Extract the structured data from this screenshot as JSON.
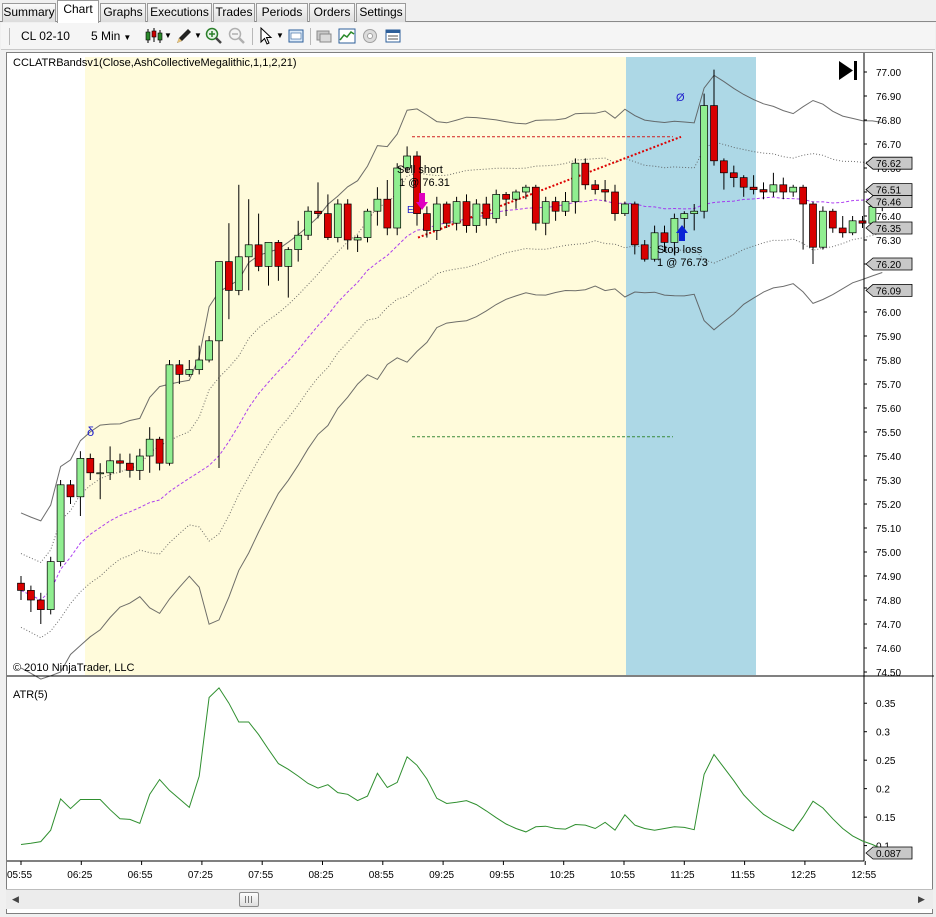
{
  "tabs": [
    "Summary",
    "Chart",
    "Graphs",
    "Executions",
    "Trades",
    "Periods",
    "Orders",
    "Settings"
  ],
  "active_tab": "Chart",
  "toolbar": {
    "instrument": "CL 02-10",
    "interval": "5 Min"
  },
  "chart": {
    "indicator_label": "CCLATRBandsv1(Close,AshCollectiveMegalithic,1,1,2,21)",
    "copyright": "© 2010 NinjaTrader, LLC",
    "atr_label": "ATR(5)",
    "sell_short_label": "Sell short",
    "sell_short_fill": "1 @ 76.31",
    "stop_loss_label": "Stop loss",
    "stop_loss_fill": "1 @ 76.73",
    "entry_marker": "E",
    "swing_low_marker": "δ",
    "swing_high_marker": "Ø"
  },
  "chart_data": {
    "type": "candlestick",
    "y_ticks": [
      "77.00",
      "76.90",
      "76.80",
      "76.70",
      "76.60",
      "76.50",
      "76.40",
      "76.30",
      "76.20",
      "76.10",
      "76.00",
      "75.90",
      "75.80",
      "75.70",
      "75.60",
      "75.50",
      "75.40",
      "75.30",
      "75.20",
      "75.10",
      "75.00",
      "74.90",
      "74.80",
      "74.70",
      "74.60",
      "74.50"
    ],
    "ylim": [
      74.5,
      77.0
    ],
    "x_ticks": [
      "05:55",
      "06:25",
      "06:55",
      "07:25",
      "07:55",
      "08:25",
      "08:55",
      "09:25",
      "09:55",
      "10:25",
      "10:55",
      "11:25",
      "11:55",
      "12:25",
      "12:55"
    ],
    "price_badges": [
      "76.62",
      "76.51",
      "76.46",
      "76.35",
      "76.20",
      "76.09"
    ],
    "atr_ticks": [
      "0.35",
      "0.3",
      "0.25",
      "0.2",
      "0.15",
      "0.1"
    ],
    "atr_ylim": [
      0.087,
      0.375
    ],
    "atr_badge": "0.087",
    "candles": [
      {
        "o": 74.87,
        "h": 74.9,
        "l": 74.8,
        "c": 74.84
      },
      {
        "o": 74.84,
        "h": 74.86,
        "l": 74.75,
        "c": 74.8
      },
      {
        "o": 74.8,
        "h": 74.83,
        "l": 74.7,
        "c": 74.76
      },
      {
        "o": 74.76,
        "h": 74.98,
        "l": 74.74,
        "c": 74.96
      },
      {
        "o": 74.96,
        "h": 75.3,
        "l": 74.94,
        "c": 75.28
      },
      {
        "o": 75.28,
        "h": 75.3,
        "l": 75.2,
        "c": 75.23
      },
      {
        "o": 75.23,
        "h": 75.42,
        "l": 75.15,
        "c": 75.39
      },
      {
        "o": 75.39,
        "h": 75.41,
        "l": 75.3,
        "c": 75.33
      },
      {
        "o": 75.33,
        "h": 75.37,
        "l": 75.22,
        "c": 75.33
      },
      {
        "o": 75.33,
        "h": 75.44,
        "l": 75.3,
        "c": 75.38
      },
      {
        "o": 75.38,
        "h": 75.41,
        "l": 75.33,
        "c": 75.37
      },
      {
        "o": 75.37,
        "h": 75.41,
        "l": 75.31,
        "c": 75.34
      },
      {
        "o": 75.34,
        "h": 75.43,
        "l": 75.3,
        "c": 75.4
      },
      {
        "o": 75.4,
        "h": 75.52,
        "l": 75.33,
        "c": 75.47
      },
      {
        "o": 75.47,
        "h": 75.48,
        "l": 75.34,
        "c": 75.37
      },
      {
        "o": 75.37,
        "h": 75.8,
        "l": 75.36,
        "c": 75.78
      },
      {
        "o": 75.78,
        "h": 75.8,
        "l": 75.7,
        "c": 75.74
      },
      {
        "o": 75.74,
        "h": 75.8,
        "l": 75.73,
        "c": 75.76
      },
      {
        "o": 75.76,
        "h": 75.86,
        "l": 75.74,
        "c": 75.8
      },
      {
        "o": 75.8,
        "h": 75.9,
        "l": 75.79,
        "c": 75.88
      },
      {
        "o": 75.88,
        "h": 76.21,
        "l": 75.35,
        "c": 76.21
      },
      {
        "o": 76.21,
        "h": 76.37,
        "l": 75.97,
        "c": 76.09
      },
      {
        "o": 76.09,
        "h": 76.53,
        "l": 76.07,
        "c": 76.23
      },
      {
        "o": 76.23,
        "h": 76.47,
        "l": 76.09,
        "c": 76.28
      },
      {
        "o": 76.28,
        "h": 76.41,
        "l": 76.17,
        "c": 76.19
      },
      {
        "o": 76.19,
        "h": 76.29,
        "l": 76.11,
        "c": 76.29
      },
      {
        "o": 76.29,
        "h": 76.3,
        "l": 76.13,
        "c": 76.19
      },
      {
        "o": 76.19,
        "h": 76.27,
        "l": 76.06,
        "c": 76.26
      },
      {
        "o": 76.26,
        "h": 76.38,
        "l": 76.21,
        "c": 76.32
      },
      {
        "o": 76.32,
        "h": 76.44,
        "l": 76.3,
        "c": 76.42
      },
      {
        "o": 76.42,
        "h": 76.54,
        "l": 76.39,
        "c": 76.41
      },
      {
        "o": 76.41,
        "h": 76.49,
        "l": 76.3,
        "c": 76.31
      },
      {
        "o": 76.31,
        "h": 76.47,
        "l": 76.29,
        "c": 76.45
      },
      {
        "o": 76.45,
        "h": 76.47,
        "l": 76.26,
        "c": 76.3
      },
      {
        "o": 76.3,
        "h": 76.32,
        "l": 76.25,
        "c": 76.31
      },
      {
        "o": 76.31,
        "h": 76.43,
        "l": 76.29,
        "c": 76.42
      },
      {
        "o": 76.42,
        "h": 76.52,
        "l": 76.36,
        "c": 76.47
      },
      {
        "o": 76.47,
        "h": 76.55,
        "l": 76.32,
        "c": 76.35
      },
      {
        "o": 76.35,
        "h": 76.62,
        "l": 76.32,
        "c": 76.6
      },
      {
        "o": 76.6,
        "h": 76.69,
        "l": 76.58,
        "c": 76.65
      },
      {
        "o": 76.65,
        "h": 76.67,
        "l": 76.36,
        "c": 76.41
      },
      {
        "o": 76.41,
        "h": 76.44,
        "l": 76.31,
        "c": 76.34
      },
      {
        "o": 76.34,
        "h": 76.48,
        "l": 76.3,
        "c": 76.45
      },
      {
        "o": 76.45,
        "h": 76.46,
        "l": 76.35,
        "c": 76.37
      },
      {
        "o": 76.37,
        "h": 76.48,
        "l": 76.34,
        "c": 76.46
      },
      {
        "o": 76.46,
        "h": 76.49,
        "l": 76.33,
        "c": 76.36
      },
      {
        "o": 76.36,
        "h": 76.47,
        "l": 76.33,
        "c": 76.45
      },
      {
        "o": 76.45,
        "h": 76.48,
        "l": 76.36,
        "c": 76.39
      },
      {
        "o": 76.39,
        "h": 76.51,
        "l": 76.37,
        "c": 76.49
      },
      {
        "o": 76.49,
        "h": 76.5,
        "l": 76.4,
        "c": 76.47
      },
      {
        "o": 76.47,
        "h": 76.51,
        "l": 76.43,
        "c": 76.5
      },
      {
        "o": 76.5,
        "h": 76.53,
        "l": 76.47,
        "c": 76.52
      },
      {
        "o": 76.52,
        "h": 76.53,
        "l": 76.34,
        "c": 76.37
      },
      {
        "o": 76.37,
        "h": 76.48,
        "l": 76.32,
        "c": 76.46
      },
      {
        "o": 76.46,
        "h": 76.48,
        "l": 76.38,
        "c": 76.42
      },
      {
        "o": 76.42,
        "h": 76.5,
        "l": 76.4,
        "c": 76.46
      },
      {
        "o": 76.46,
        "h": 76.64,
        "l": 76.41,
        "c": 76.62
      },
      {
        "o": 76.62,
        "h": 76.64,
        "l": 76.51,
        "c": 76.53
      },
      {
        "o": 76.53,
        "h": 76.55,
        "l": 76.49,
        "c": 76.51
      },
      {
        "o": 76.51,
        "h": 76.55,
        "l": 76.46,
        "c": 76.5
      },
      {
        "o": 76.5,
        "h": 76.53,
        "l": 76.38,
        "c": 76.41
      },
      {
        "o": 76.41,
        "h": 76.46,
        "l": 76.4,
        "c": 76.45
      },
      {
        "o": 76.45,
        "h": 76.46,
        "l": 76.24,
        "c": 76.28
      },
      {
        "o": 76.28,
        "h": 76.3,
        "l": 76.21,
        "c": 76.22
      },
      {
        "o": 76.22,
        "h": 76.36,
        "l": 76.21,
        "c": 76.33
      },
      {
        "o": 76.33,
        "h": 76.36,
        "l": 76.25,
        "c": 76.29
      },
      {
        "o": 76.29,
        "h": 76.41,
        "l": 76.24,
        "c": 76.39
      },
      {
        "o": 76.39,
        "h": 76.42,
        "l": 76.31,
        "c": 76.41
      },
      {
        "o": 76.41,
        "h": 76.45,
        "l": 76.34,
        "c": 76.42
      },
      {
        "o": 76.42,
        "h": 76.91,
        "l": 76.39,
        "c": 76.86
      },
      {
        "o": 76.86,
        "h": 77.01,
        "l": 76.61,
        "c": 76.63
      },
      {
        "o": 76.63,
        "h": 76.64,
        "l": 76.51,
        "c": 76.58
      },
      {
        "o": 76.58,
        "h": 76.61,
        "l": 76.52,
        "c": 76.56
      },
      {
        "o": 76.56,
        "h": 76.57,
        "l": 76.48,
        "c": 76.52
      },
      {
        "o": 76.52,
        "h": 76.57,
        "l": 76.49,
        "c": 76.51
      },
      {
        "o": 76.51,
        "h": 76.54,
        "l": 76.47,
        "c": 76.5
      },
      {
        "o": 76.5,
        "h": 76.58,
        "l": 76.48,
        "c": 76.53
      },
      {
        "o": 76.53,
        "h": 76.56,
        "l": 76.47,
        "c": 76.5
      },
      {
        "o": 76.5,
        "h": 76.53,
        "l": 76.48,
        "c": 76.52
      },
      {
        "o": 76.52,
        "h": 76.53,
        "l": 76.26,
        "c": 76.45
      },
      {
        "o": 76.45,
        "h": 76.46,
        "l": 76.2,
        "c": 76.27
      },
      {
        "o": 76.27,
        "h": 76.44,
        "l": 76.26,
        "c": 76.42
      },
      {
        "o": 76.42,
        "h": 76.43,
        "l": 76.33,
        "c": 76.35
      },
      {
        "o": 76.35,
        "h": 76.4,
        "l": 76.31,
        "c": 76.33
      },
      {
        "o": 76.33,
        "h": 76.4,
        "l": 76.32,
        "c": 76.38
      },
      {
        "o": 76.38,
        "h": 76.4,
        "l": 76.35,
        "c": 76.37
      },
      {
        "o": 76.37,
        "h": 76.45,
        "l": 76.35,
        "c": 76.44
      },
      {
        "o": 76.44,
        "h": 76.48,
        "l": 76.42,
        "c": 76.47
      }
    ],
    "atr_values": [
      0.102,
      0.104,
      0.107,
      0.127,
      0.182,
      0.165,
      0.181,
      0.181,
      0.181,
      0.163,
      0.147,
      0.146,
      0.139,
      0.19,
      0.216,
      0.197,
      0.182,
      0.167,
      0.222,
      0.36,
      0.377,
      0.35,
      0.317,
      0.317,
      0.295,
      0.269,
      0.244,
      0.234,
      0.222,
      0.209,
      0.201,
      0.207,
      0.193,
      0.19,
      0.179,
      0.187,
      0.227,
      0.202,
      0.211,
      0.256,
      0.241,
      0.217,
      0.183,
      0.174,
      0.176,
      0.179,
      0.172,
      0.161,
      0.149,
      0.138,
      0.13,
      0.124,
      0.133,
      0.134,
      0.13,
      0.129,
      0.137,
      0.136,
      0.13,
      0.141,
      0.127,
      0.154,
      0.136,
      0.13,
      0.127,
      0.13,
      0.133,
      0.132,
      0.128,
      0.225,
      0.26,
      0.237,
      0.214,
      0.189,
      0.171,
      0.155,
      0.144,
      0.135,
      0.126,
      0.15,
      0.178,
      0.166,
      0.147,
      0.13,
      0.117,
      0.108,
      0.102,
      0.094,
      0.091
    ],
    "colors": {
      "up": "#90ee90",
      "down": "#d80000",
      "session": "#fffbdb",
      "highlight": "#add8e6",
      "mid_line": "#a020f0",
      "target_line": "#3a8a3a",
      "stop_line": "#d02020",
      "atr_line": "#2f8f2f"
    }
  }
}
